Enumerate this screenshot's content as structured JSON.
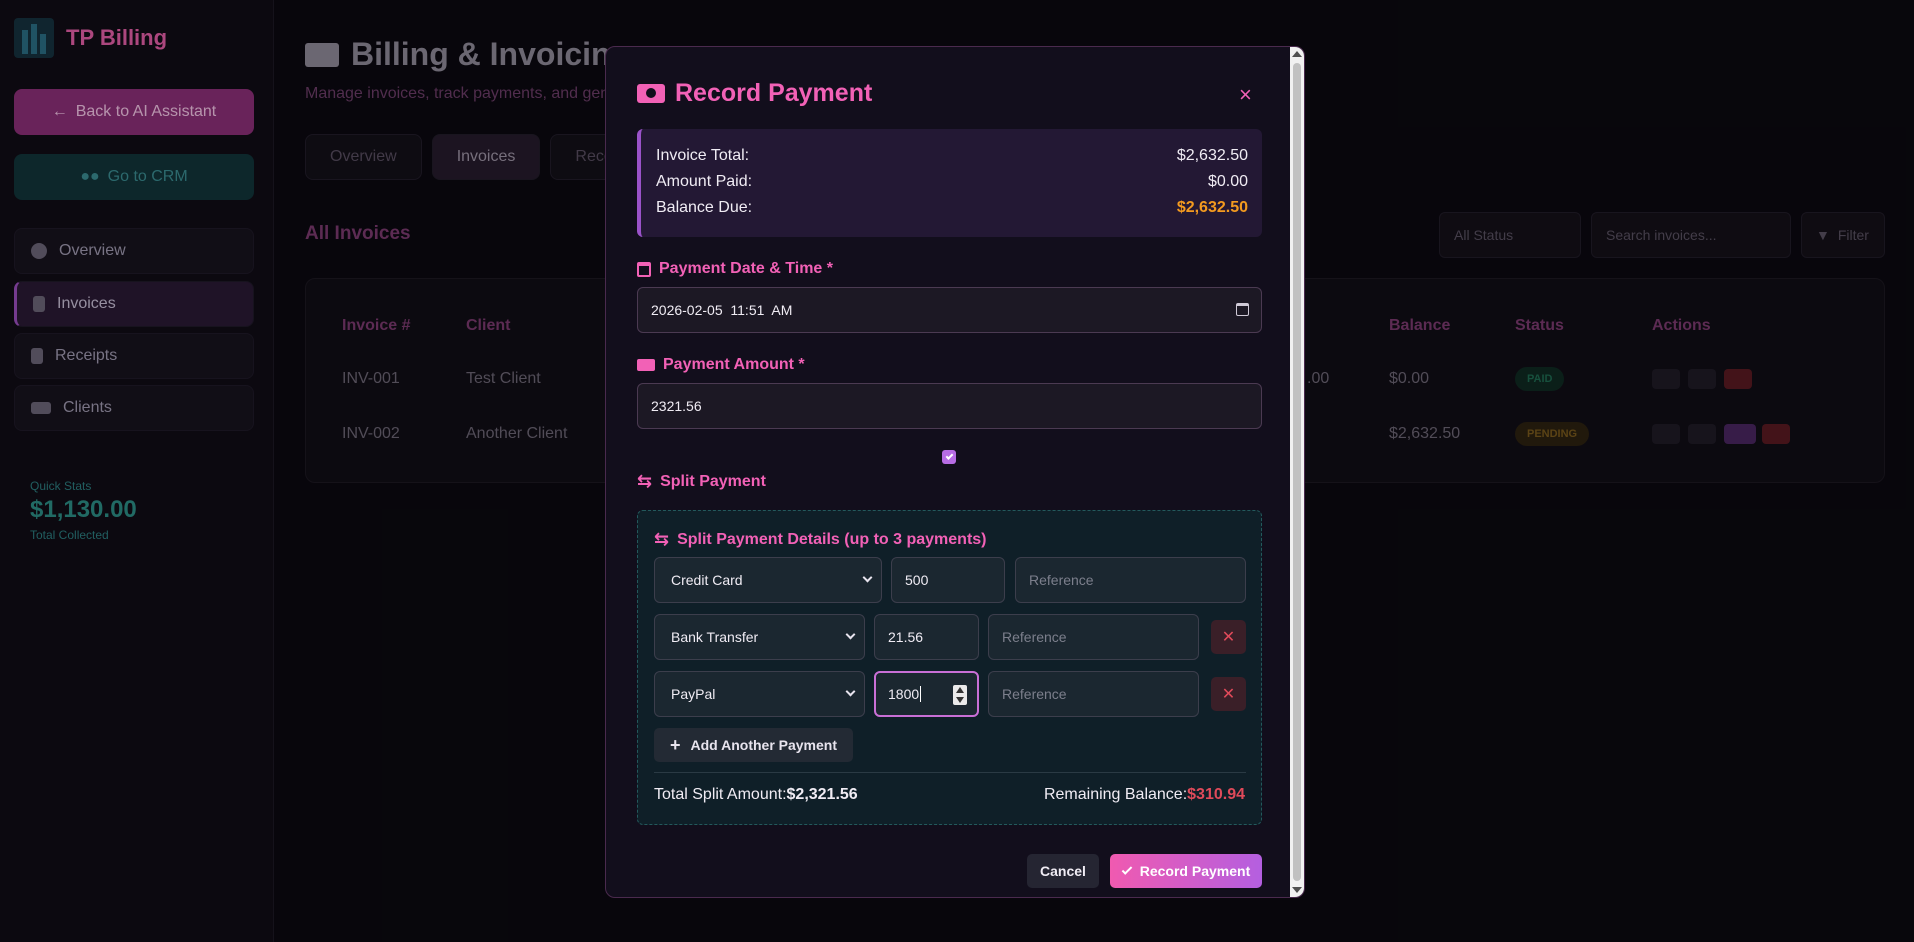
{
  "app": {
    "brand": "TP Billing",
    "back_label": "Back to AI Assistant",
    "crm_label": "Go to CRM",
    "nav": [
      {
        "label": "Overview"
      },
      {
        "label": "Invoices"
      },
      {
        "label": "Receipts"
      },
      {
        "label": "Clients"
      }
    ],
    "quick_stats": {
      "label": "Quick Stats",
      "value": "$1,130.00",
      "sub": "Total Collected"
    }
  },
  "page": {
    "title": "Billing & Invoicin",
    "subtitle": "Manage invoices, track payments, and gen",
    "tabs": [
      {
        "label": "Overview"
      },
      {
        "label": "Invoices"
      },
      {
        "label": "Rece"
      }
    ],
    "section_title": "All Invoices",
    "status_filter": "All Status",
    "search_placeholder": "Search invoices...",
    "filter_label": "Filter",
    "table": {
      "headers": {
        "invoice": "Invoice #",
        "client": "Client",
        "balance": "Balance",
        "status": "Status",
        "actions": "Actions"
      },
      "rows": [
        {
          "invoice": "INV-001",
          "client": "Test Client",
          "paid_partial": ".00",
          "balance": "$0.00",
          "status": "PAID"
        },
        {
          "invoice": "INV-002",
          "client": "Another Client",
          "balance": "$2,632.50",
          "status": "PENDING"
        }
      ]
    }
  },
  "modal": {
    "title": "Record Payment",
    "close": "×",
    "summary": {
      "total_label": "Invoice Total:",
      "total_value": "$2,632.50",
      "paid_label": "Amount Paid:",
      "paid_value": "$0.00",
      "due_label": "Balance Due:",
      "due_value": "$2,632.50"
    },
    "date_label": "Payment Date & Time *",
    "date_value": "2026-02-05  11:51  AM",
    "amount_label": "Payment Amount *",
    "amount_value": "2321.56",
    "split_checkbox_checked": true,
    "split_label": "Split Payment",
    "split": {
      "title": "Split Payment Details (up to 3 payments)",
      "reference_placeholder": "Reference",
      "payments": [
        {
          "method": "Credit Card",
          "amount": "500"
        },
        {
          "method": "Bank Transfer",
          "amount": "21.56"
        },
        {
          "method": "PayPal",
          "amount": "1800"
        }
      ],
      "add_label": "Add Another Payment",
      "total_label": "Total Split Amount:",
      "total_value": "$2,321.56",
      "remaining_label": "Remaining Balance:",
      "remaining_value": "$310.94"
    },
    "cancel_label": "Cancel",
    "submit_label": "Record Payment"
  },
  "colors": {
    "accent": "#f261b6",
    "warning": "#f39a1f",
    "danger": "#e04a5a",
    "purple": "#9a52c9"
  }
}
